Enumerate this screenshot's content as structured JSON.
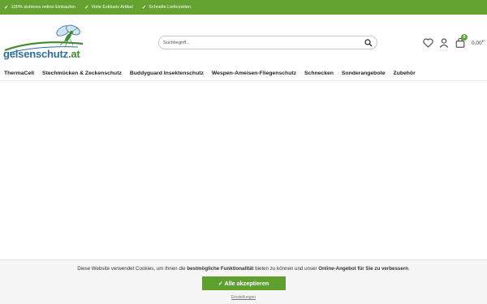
{
  "topbar": {
    "usps": [
      "100% sicheres online Einkaufen",
      "Viele Exklusiv Artikel",
      "Schnelle Lieferzeiten"
    ],
    "check_icon": "✓",
    "background": "#64a32f"
  },
  "header": {
    "logo": {
      "name": "gelsenschutz",
      "tld": ".at"
    },
    "search": {
      "placeholder": "Suchbegriff...",
      "icon": "search-icon"
    },
    "actions": {
      "wishlist_icon": "heart-icon",
      "account_icon": "user-icon",
      "cart_icon": "bag-icon",
      "cart_count": "0",
      "cart_total": "0,00",
      "cart_currency": "€*"
    }
  },
  "nav": {
    "items": [
      "ThermaCell",
      "Stechmücken & Zeckenschutz",
      "Buddyguard Insektenschutz",
      "Wespen-Ameisen-Fliegenschutz",
      "Schnecken",
      "Sonderangebote",
      "Zubehör"
    ]
  },
  "cookie": {
    "text_1": "Diese Website verwendet Cookies, um Ihnen die ",
    "text_2": "bestmögliche Funktionalität",
    "text_3": " bieten zu können und unser ",
    "text_4": "Online-Angebot für Sie zu verbessern",
    "text_5": ".",
    "accept_label": "✓ Alle akzeptieren",
    "settings_label": "Einstellungen",
    "accent": "#5f9f2c"
  }
}
